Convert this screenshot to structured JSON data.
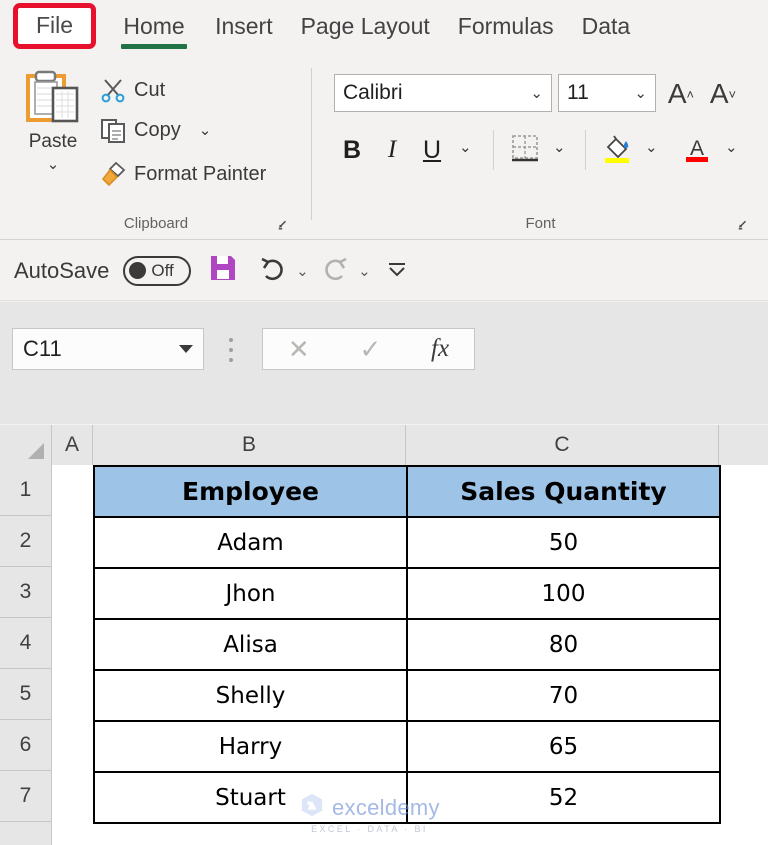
{
  "ribbon": {
    "tabs": [
      {
        "id": "file",
        "label": "File",
        "selected": false,
        "highlighted": true
      },
      {
        "id": "home",
        "label": "Home",
        "selected": true,
        "highlighted": false
      },
      {
        "id": "insert",
        "label": "Insert",
        "selected": false,
        "highlighted": false
      },
      {
        "id": "page_layout",
        "label": "Page Layout",
        "selected": false,
        "highlighted": false
      },
      {
        "id": "formulas",
        "label": "Formulas",
        "selected": false,
        "highlighted": false
      },
      {
        "id": "data",
        "label": "Data",
        "selected": false,
        "highlighted": false
      }
    ],
    "highlight_color": "#e8112d",
    "active_tab_underline_color": "#217346",
    "clipboard": {
      "group_label": "Clipboard",
      "paste_label": "Paste",
      "cut_label": "Cut",
      "copy_label": "Copy",
      "format_painter_label": "Format Painter"
    },
    "font": {
      "group_label": "Font",
      "font_name": "Calibri",
      "font_size": "11",
      "bold_label": "B",
      "italic_label": "I",
      "underline_label": "U",
      "grow_font_label": "A",
      "shrink_font_label": "A",
      "highlight_color": "#ffff00",
      "font_color": "#ff0000"
    }
  },
  "quick_access": {
    "autosave_label": "AutoSave",
    "autosave_state": "Off",
    "save_color": "#b146c2"
  },
  "formula_bar": {
    "name_box_value": "C11",
    "input_value": "",
    "cancel_label": "✕",
    "enter_label": "✓",
    "function_label": "fx"
  },
  "sheet": {
    "column_headers": [
      "A",
      "B",
      "C"
    ],
    "row_headers": [
      "1",
      "2",
      "3",
      "4",
      "5",
      "6",
      "7"
    ],
    "header_fill": "#9dc3e6",
    "table": {
      "headers": [
        "Employee",
        "Sales Quantity"
      ],
      "rows": [
        [
          "Adam",
          "50"
        ],
        [
          "Jhon",
          "100"
        ],
        [
          "Alisa",
          "80"
        ],
        [
          "Shelly",
          "70"
        ],
        [
          "Harry",
          "65"
        ],
        [
          "Stuart",
          "52"
        ]
      ]
    }
  },
  "watermark": {
    "text": "exceldemy",
    "subtext": "EXCEL · DATA · BI"
  }
}
